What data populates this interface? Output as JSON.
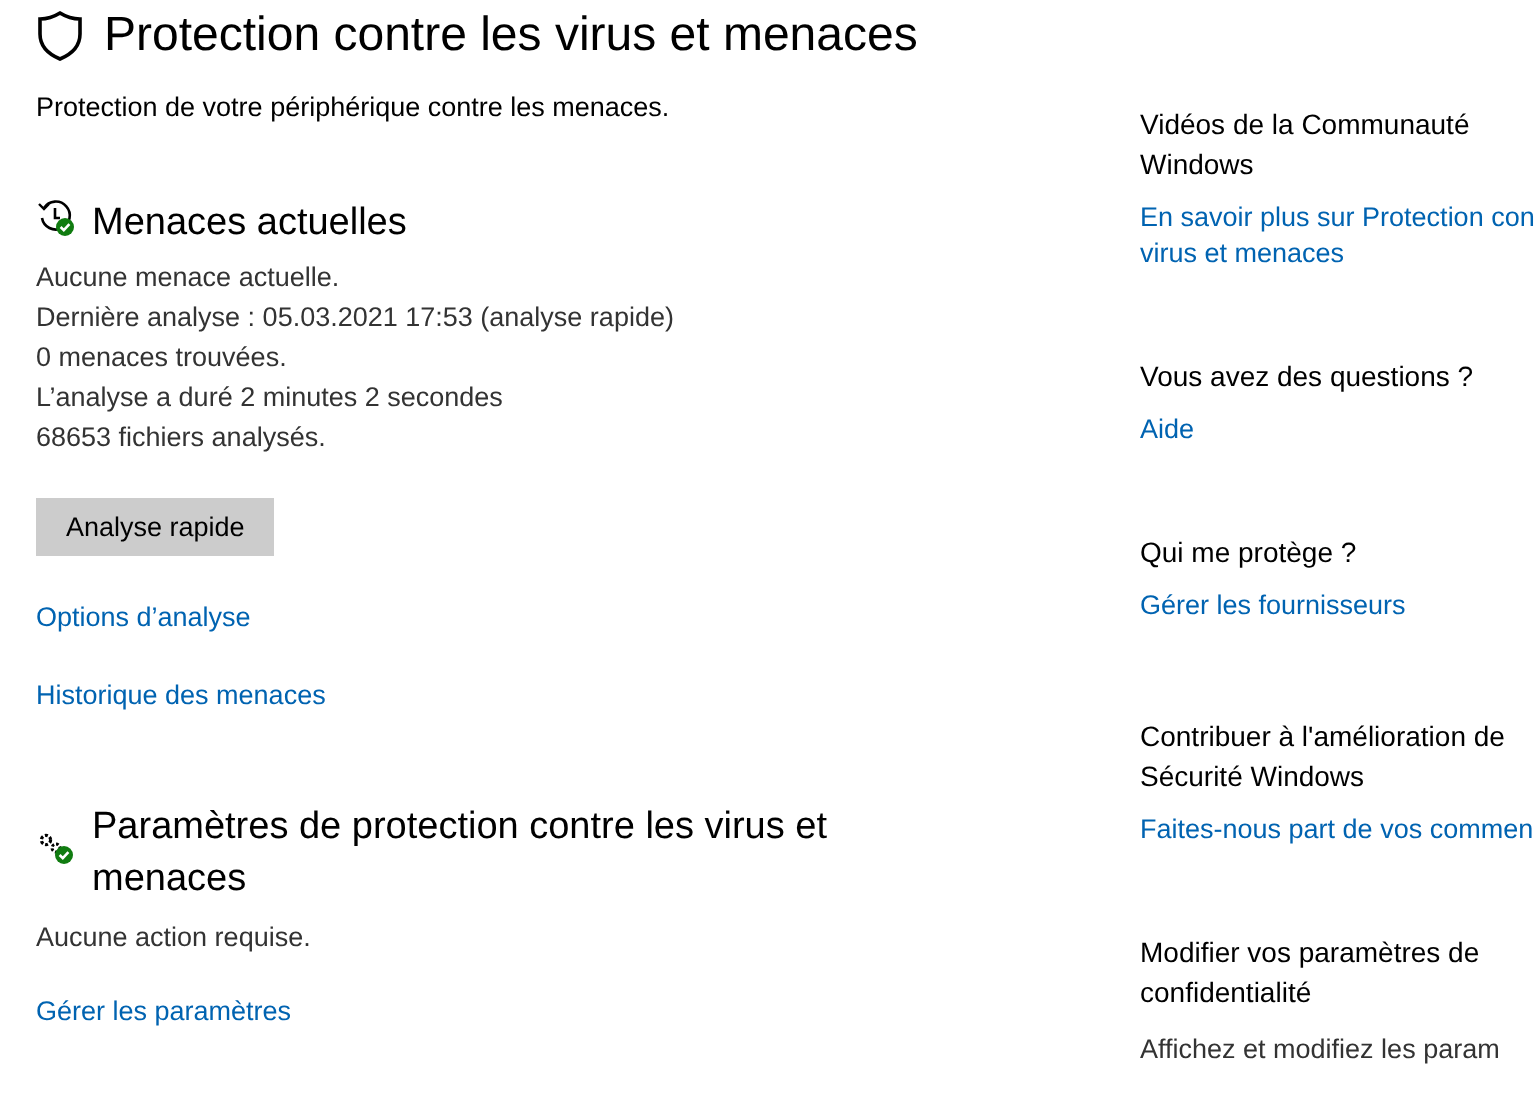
{
  "page": {
    "title": "Protection contre les virus et menaces",
    "subtitle": "Protection de votre périphérique contre les menaces."
  },
  "current_threats": {
    "heading": "Menaces actuelles",
    "lines": [
      "Aucune menace actuelle.",
      "Dernière analyse : 05.03.2021 17:53 (analyse rapide)",
      "0 menaces trouvées.",
      "L’analyse a duré 2 minutes 2 secondes",
      "68653 fichiers analysés."
    ],
    "button": "Analyse rapide",
    "links": [
      "Options d’analyse",
      "Historique des menaces"
    ]
  },
  "settings": {
    "heading": "Paramètres de protection contre les virus et menaces",
    "status": "Aucune action requise.",
    "link": "Gérer les paramètres"
  },
  "sidebar": [
    {
      "heading": "Vidéos de la Communauté Windows",
      "kind": "link",
      "text": "En savoir plus sur Protection con\nvirus et menaces"
    },
    {
      "heading": "Vous avez des questions ?",
      "kind": "link",
      "text": "Aide"
    },
    {
      "heading": "Qui me protège ?",
      "kind": "link",
      "text": "Gérer les fournisseurs"
    },
    {
      "heading": "Contribuer à l'amélioration de Sécurité Windows",
      "kind": "link",
      "text": "Faites-nous part de vos commen"
    },
    {
      "heading": "Modifier vos paramètres de confidentialité",
      "kind": "text",
      "text": "Affichez et modifiez les param"
    }
  ]
}
